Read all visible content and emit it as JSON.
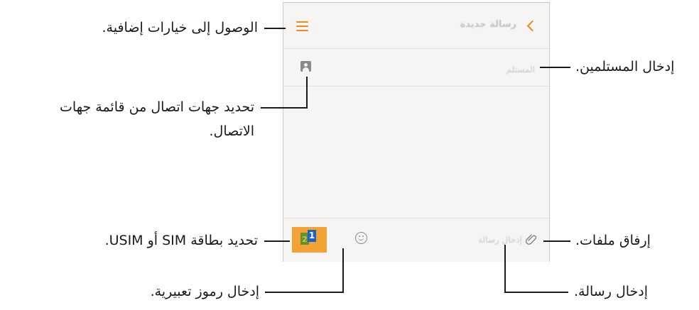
{
  "screen": {
    "title": "رسالة جديدة",
    "recipient_placeholder": "المستلم",
    "message_placeholder": "إدخال رسالة",
    "sim_indicator": {
      "back_number": "2",
      "front_number": "1"
    }
  },
  "callouts": {
    "more_options": "الوصول إلى خيارات إضافية.",
    "select_contacts_line1": "تحديد جهات اتصال من قائمة جهات",
    "select_contacts_line2": "الاتصال.",
    "select_sim": "تحديد بطاقة SIM أو USIM.",
    "emoticons": "إدخال رموز تعبيرية.",
    "recipients": "إدخال المستلمين.",
    "attach": "إرفاق ملفات.",
    "message": "إدخال رسالة."
  },
  "icons": {
    "menu": "menu-lines-icon",
    "back": "chevron-back-icon",
    "contact": "contact-card-icon",
    "sim": "sim-card-icon",
    "emoji": "smiley-icon",
    "attach": "paperclip-icon"
  },
  "colors": {
    "accent": "#f08a1d",
    "sim_button": "#f3a333",
    "sim_front": "#1d63c7",
    "sim_back": "#6a8e2a"
  }
}
